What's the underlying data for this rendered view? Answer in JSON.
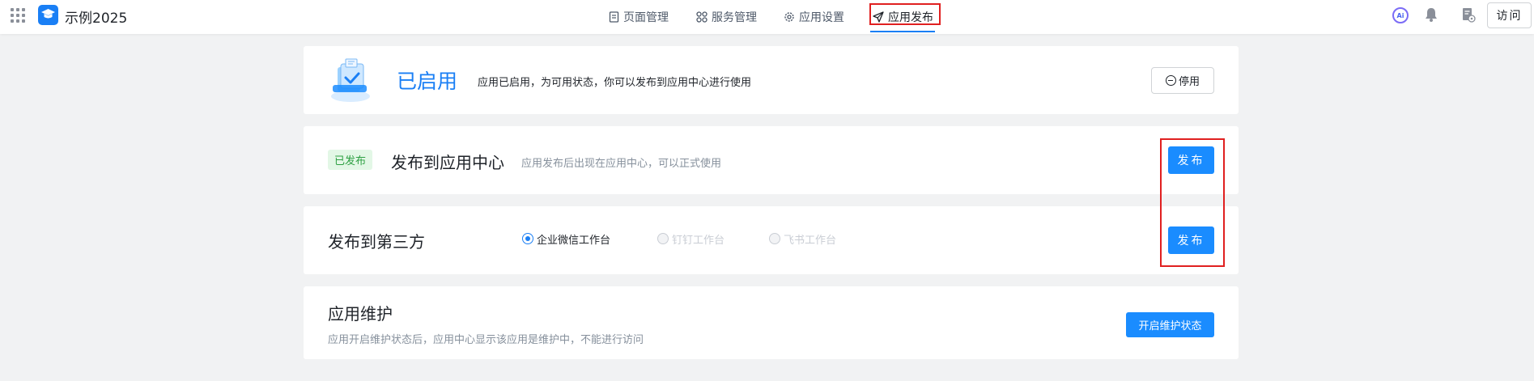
{
  "topbar": {
    "app_name": "示例2025",
    "nav": [
      {
        "label": "页面管理",
        "icon": "page-icon"
      },
      {
        "label": "服务管理",
        "icon": "grid-icon"
      },
      {
        "label": "应用设置",
        "icon": "gear-icon"
      },
      {
        "label": "应用发布",
        "icon": "send-icon",
        "active": true
      }
    ],
    "ai_label": "Ai",
    "visit_label": "访问"
  },
  "status_card": {
    "title": "已启用",
    "description": "应用已启用，为可用状态，你可以发布到应用中心进行使用",
    "disable_label": "停用"
  },
  "app_center_card": {
    "badge": "已发布",
    "title": "发布到应用中心",
    "description": "应用发布后出现在应用中心，可以正式使用",
    "publish_label": "发布"
  },
  "third_party_card": {
    "title": "发布到第三方",
    "options": [
      {
        "label": "企业微信工作台",
        "checked": true,
        "disabled": false
      },
      {
        "label": "钉钉工作台",
        "checked": false,
        "disabled": true
      },
      {
        "label": "飞书工作台",
        "checked": false,
        "disabled": true
      }
    ],
    "publish_label": "发布"
  },
  "maintenance_card": {
    "title": "应用维护",
    "description": "应用开启维护状态后，应用中心显示该应用是维护中，不能进行访问",
    "button_label": "开启维护状态"
  },
  "colors": {
    "accent": "#1a7ff5",
    "highlight": "#e02020",
    "published_badge": "#2ea043"
  }
}
